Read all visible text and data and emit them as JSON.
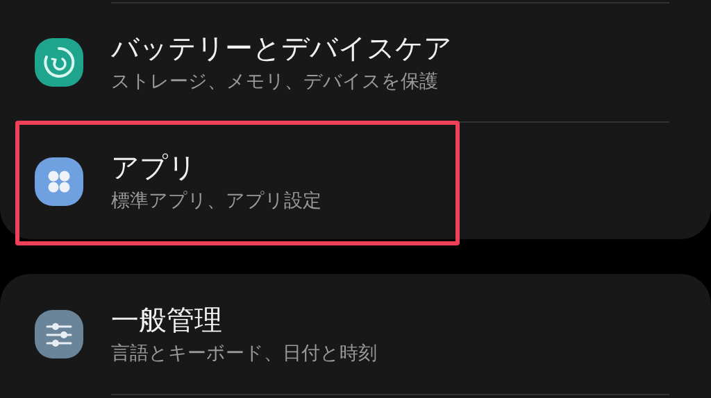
{
  "groups": [
    {
      "items": [
        {
          "kind": "battery",
          "title": "バッテリーとデバイスケア",
          "subtitle": "ストレージ、メモリ、デバイスを保護",
          "highlighted": false
        },
        {
          "kind": "apps",
          "title": "アプリ",
          "subtitle": "標準アプリ、アプリ設定",
          "highlighted": true
        }
      ]
    },
    {
      "items": [
        {
          "kind": "general",
          "title": "一般管理",
          "subtitle": "言語とキーボード、日付と時刻",
          "highlighted": false
        }
      ]
    }
  ]
}
